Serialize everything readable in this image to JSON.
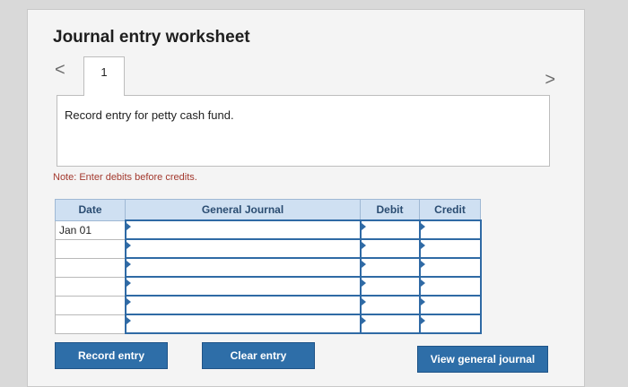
{
  "title": "Journal entry worksheet",
  "nav": {
    "prev": "<",
    "next": ">"
  },
  "tab_label": "1",
  "description": "Record entry for petty cash fund.",
  "note": "Note: Enter debits before credits.",
  "table": {
    "headers": [
      "Date",
      "General Journal",
      "Debit",
      "Credit"
    ],
    "rows": [
      {
        "date": "Jan 01"
      },
      {
        "date": ""
      },
      {
        "date": ""
      },
      {
        "date": ""
      },
      {
        "date": ""
      },
      {
        "date": ""
      }
    ]
  },
  "buttons": {
    "record": "Record entry",
    "clear": "Clear entry",
    "view": "View general journal"
  },
  "colors": {
    "accent": "#2e6ea8",
    "header_bg": "#cfe0f2",
    "note": "#a3392e"
  }
}
